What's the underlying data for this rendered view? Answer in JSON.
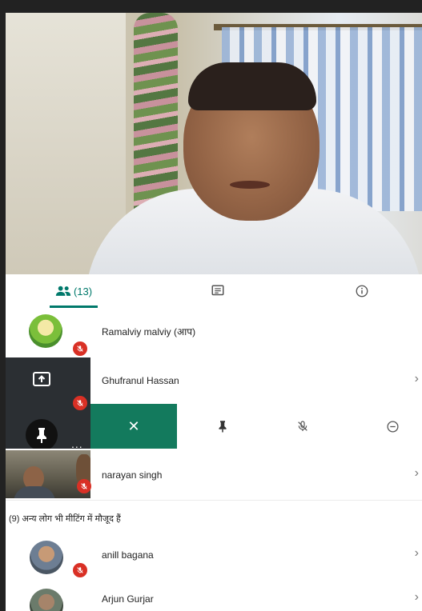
{
  "tabs": {
    "people_count": "(13)",
    "chat_label": "",
    "info_label": ""
  },
  "participants": [
    {
      "name": "Ramalviy malviy (आप)"
    },
    {
      "name": "Ghufranul Hassan"
    },
    {
      "name": "narayan singh"
    }
  ],
  "others_heading": "(9) अन्य लोग भी मीटिंग में मौजूद हैं",
  "others": [
    {
      "name": "anill bagana"
    },
    {
      "name": "Arjun Gurjar"
    }
  ],
  "actions": {
    "close": "✕"
  },
  "colors": {
    "accent": "#00796b",
    "action_bar_active": "#137a5d",
    "mute_red": "#d93025"
  }
}
